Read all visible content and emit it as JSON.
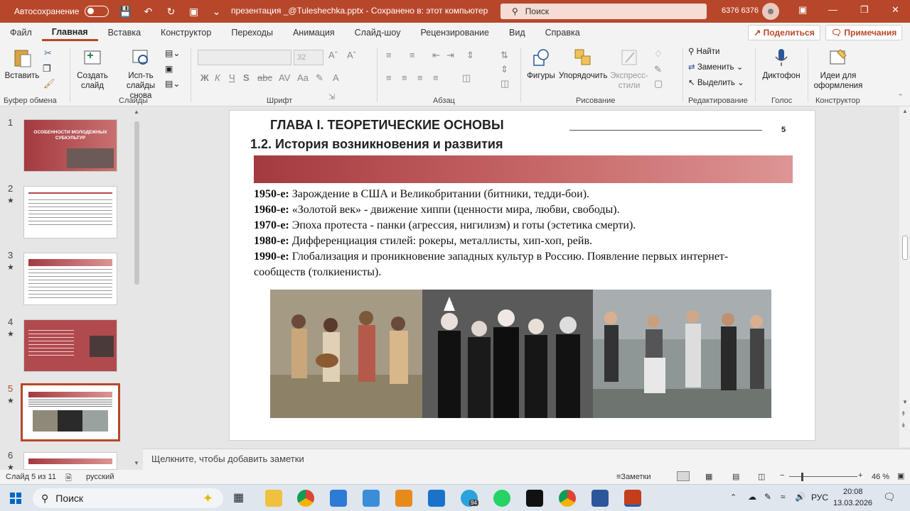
{
  "titlebar": {
    "autosave_label": "Автосохранение",
    "doc_title": "презентация _@Tuleshechka.pptx  -  Сохранено в: этот компьютер",
    "search_placeholder": "Поиск",
    "user_name": "6376 6376"
  },
  "menu": {
    "tabs": [
      "Файл",
      "Главная",
      "Вставка",
      "Конструктор",
      "Переходы",
      "Анимация",
      "Слайд-шоу",
      "Рецензирование",
      "Вид",
      "Справка"
    ],
    "active": "Главная",
    "share_label": "Поделиться",
    "comments_label": "Примечания"
  },
  "ribbon": {
    "paste": "Вставить",
    "clipboard_group": "Буфер обмена",
    "new_slide_1": "Создать",
    "new_slide_2": "слайд",
    "reuse_1": "Исп-ть",
    "reuse_2": "слайды снова",
    "slides_group": "Слайды",
    "font_size": "32",
    "font_group": "Шрифт",
    "paragraph_group": "Абзац",
    "shapes": "Фигуры",
    "arrange": "Упорядочить",
    "styles_1": "Экспресс-",
    "styles_2": "стили",
    "drawing_group": "Рисование",
    "find": "Найти",
    "replace": "Заменить",
    "select": "Выделить",
    "editing_group": "Редактирование",
    "dictate": "Диктофон",
    "voice_group": "Голос",
    "designer_1": "Идеи для",
    "designer_2": "оформления",
    "designer_group": "Конструктор"
  },
  "thumbnails": {
    "numbers": [
      "1",
      "2",
      "3",
      "4",
      "5",
      "6"
    ],
    "slide1_title": "ОСОБЕННОСТИ МОЛОДЕЖНЫХ СУБКУЛЬТУР",
    "selected": "5"
  },
  "slide": {
    "heading1": "ГЛАВА I. ТЕОРЕТИЧЕСКИЕ ОСНОВЫ",
    "heading2": "1.2. История возникновения и развития",
    "page_number": "5",
    "items": [
      {
        "year": "1950-е:",
        "text": " Зарождение в США и Великобритании (битники, тедди-бои)."
      },
      {
        "year": "1960-е:",
        "text": " «Золотой век» - движение хиппи (ценности мира, любви, свободы)."
      },
      {
        "year": "1970-е:",
        "text": " Эпоха протеста - панки (агрессия, нигилизм) и готы (эстетика смерти)."
      },
      {
        "year": "1980-е:",
        "text": " Дифференциация стилей: рокеры, металлисты, хип-хоп, рейв."
      },
      {
        "year": "1990-е:",
        "text": " Глобализация и проникновение западных культур в Россию. Появление первых интернет-сообществ (толкиенисты)."
      }
    ]
  },
  "notes_placeholder": "Щелкните, чтобы добавить заметки",
  "statusbar": {
    "slide_info": "Слайд 5 из 11",
    "language": "русский",
    "notes_btn": "Заметки",
    "zoom": "46 %"
  },
  "taskbar": {
    "search": "Поиск",
    "lang": "РУС",
    "time": "20:08",
    "date": "13.03.2026",
    "telegram_badge": "94"
  },
  "colors": {
    "accent": "#b7472a",
    "band_start": "#a33a40",
    "band_end": "#dd9595"
  }
}
